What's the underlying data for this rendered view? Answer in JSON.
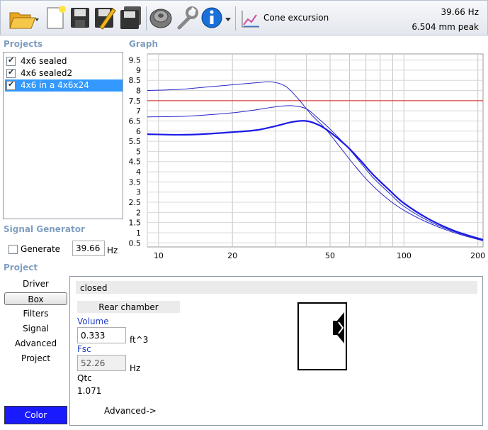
{
  "toolbar": {
    "icons": [
      "folder-open-icon",
      "new-file-icon",
      "save-icon",
      "save-edit-icon",
      "save-as-icon",
      "speaker-icon",
      "wrench-icon",
      "info-icon"
    ],
    "mode_label": "Cone excursion",
    "readout_freq": "39.66 Hz",
    "readout_value": "6.504 mm peak"
  },
  "projects": {
    "title": "Projects",
    "items": [
      {
        "label": "4x6 sealed",
        "checked": true,
        "selected": false
      },
      {
        "label": "4x6 sealed2",
        "checked": true,
        "selected": false
      },
      {
        "label": "4x6 in a 4x6x24",
        "checked": true,
        "selected": true
      }
    ]
  },
  "graph": {
    "title": "Graph"
  },
  "signal_generator": {
    "title": "Signal Generator",
    "generate_label": "Generate",
    "frequency_value": "39.66",
    "frequency_unit": "Hz"
  },
  "project_section": {
    "title": "Project",
    "nav": [
      "Driver",
      "Box",
      "Filters",
      "Signal",
      "Advanced",
      "Project"
    ],
    "active_nav": "Box",
    "color_button": "Color",
    "color_hex": "#1a1aff"
  },
  "box_panel": {
    "type": "closed",
    "rear_chamber": "Rear chamber",
    "volume_label": "Volume",
    "volume_value": "0.333",
    "volume_unit": "ft^3",
    "fsc_label": "Fsc",
    "fsc_value": "52.26",
    "fsc_unit": "Hz",
    "qtc_label": "Qtc",
    "qtc_value": "1.071",
    "advanced_link": "Advanced->"
  },
  "chart_data": {
    "type": "line",
    "xscale": "log",
    "xlim": [
      9,
      210
    ],
    "ylim": [
      0.3,
      9.8
    ],
    "xticks": [
      10,
      20,
      50,
      100,
      200
    ],
    "yticks": [
      9.5,
      9,
      8.5,
      8,
      7.5,
      7,
      6.5,
      6,
      5.5,
      5,
      4.5,
      4,
      3.5,
      3,
      2.5,
      2,
      1.5,
      1,
      0.5
    ],
    "grid": true,
    "reference_line": {
      "y": 7.5,
      "color": "#d02020"
    },
    "series": [
      {
        "color": "#2828c8",
        "width": 1,
        "x": [
          9,
          12,
          15,
          20,
          25,
          29,
          33,
          37,
          42,
          48,
          55,
          63,
          72,
          85,
          100,
          125,
          160,
          210
        ],
        "y": [
          8.0,
          8.05,
          8.15,
          8.28,
          8.38,
          8.42,
          8.2,
          7.6,
          6.8,
          6.1,
          5.2,
          4.3,
          3.5,
          2.7,
          2.1,
          1.5,
          1.0,
          0.6
        ]
      },
      {
        "color": "#2828c8",
        "width": 1,
        "x": [
          9,
          12,
          15,
          20,
          25,
          30,
          35,
          40,
          45,
          50,
          58,
          66,
          75,
          88,
          100,
          125,
          160,
          210
        ],
        "y": [
          6.7,
          6.72,
          6.78,
          6.9,
          7.05,
          7.2,
          7.25,
          7.1,
          6.6,
          6.1,
          5.3,
          4.5,
          3.7,
          2.9,
          2.3,
          1.6,
          1.05,
          0.62
        ]
      },
      {
        "color": "#1a1ae6",
        "width": 2.2,
        "x": [
          9,
          12,
          15,
          20,
          25,
          30,
          35,
          40,
          45,
          50,
          58,
          66,
          75,
          88,
          100,
          125,
          160,
          210
        ],
        "y": [
          5.85,
          5.82,
          5.85,
          5.95,
          6.05,
          6.25,
          6.45,
          6.5,
          6.3,
          5.95,
          5.3,
          4.6,
          3.85,
          3.05,
          2.45,
          1.7,
          1.1,
          0.65
        ]
      }
    ]
  }
}
